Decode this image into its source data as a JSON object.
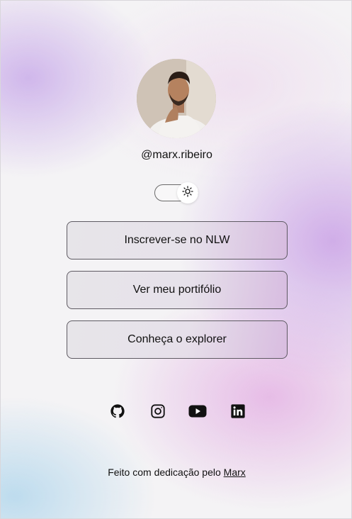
{
  "profile": {
    "username": "@marx.ribeiro",
    "avatar_icon": "profile-photo"
  },
  "theme_toggle": {
    "state": "light",
    "icon": "sun-icon"
  },
  "links": [
    {
      "label": "Inscrever-se no NLW"
    },
    {
      "label": "Ver meu portifólio"
    },
    {
      "label": "Conheça o explorer"
    }
  ],
  "socials": [
    {
      "icon": "github-icon"
    },
    {
      "icon": "instagram-icon"
    },
    {
      "icon": "youtube-icon"
    },
    {
      "icon": "linkedin-icon"
    }
  ],
  "footer": {
    "text": "Feito com dedicação pelo ",
    "link_label": "Marx"
  },
  "colors": {
    "button_border": "#5e5a62",
    "text": "#111111",
    "accent_purple": "#c496e4"
  }
}
